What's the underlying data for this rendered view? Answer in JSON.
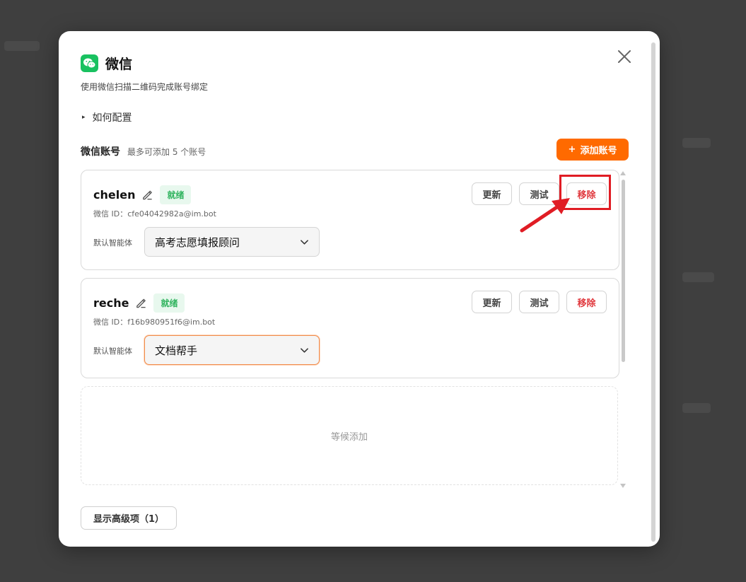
{
  "dialog": {
    "title": "微信",
    "subtitle": "使用微信扫描二维码完成账号绑定",
    "how_to_label": "如何配置",
    "accounts_label": "微信账号",
    "accounts_hint": "最多可添加 5 个账号",
    "add_button_label": "添加账号",
    "add_button_icon": "+",
    "pending_text": "等候添加",
    "advanced_button_label": "显示高级项（1）",
    "brand_color": "#ff6a00",
    "icons": [
      "wechat-icon",
      "close-icon",
      "edit-icon",
      "chevron-down-icon"
    ]
  },
  "accounts": [
    {
      "name": "chelen",
      "status": "就绪",
      "wx_id_label": "微信 ID：",
      "wx_id": "cfe04042982a@im.bot",
      "agent_label": "默认智能体",
      "agent_value": "高考志愿填报顾问",
      "update_label": "更新",
      "test_label": "测试",
      "remove_label": "移除"
    },
    {
      "name": "reche",
      "status": "就绪",
      "wx_id_label": "微信 ID：",
      "wx_id": "f16b980951f6@im.bot",
      "agent_label": "默认智能体",
      "agent_value": "文档帮手",
      "update_label": "更新",
      "test_label": "测试",
      "remove_label": "移除"
    }
  ]
}
